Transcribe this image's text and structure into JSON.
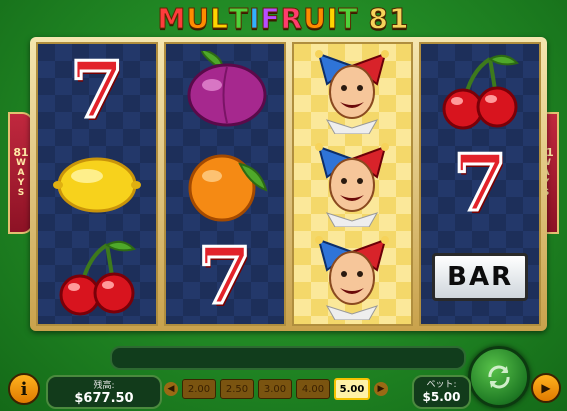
{
  "title": {
    "letters": [
      "M",
      "U",
      "L",
      "T",
      "I",
      "F",
      "R",
      "U",
      "I",
      "T"
    ],
    "letter_colors": [
      "#ff3c3c",
      "#ff8c00",
      "#ffd400",
      "#4fd13a",
      "#33b0ff",
      "#b84dff",
      "#ff3c6e",
      "#ff8c00",
      "#ffd400",
      "#4fd13a"
    ],
    "number": "81"
  },
  "side_panels": {
    "ways_number": "81",
    "ways_word": [
      "W",
      "A",
      "Y",
      "S"
    ]
  },
  "reels": [
    {
      "win": false,
      "symbols": [
        "seven-symbol",
        "lemon-symbol",
        "cherries-symbol"
      ]
    },
    {
      "win": false,
      "symbols": [
        "plum-symbol",
        "orange-symbol",
        "seven-symbol"
      ]
    },
    {
      "win": true,
      "symbols": [
        "jester-symbol",
        "jester-symbol",
        "jester-symbol"
      ]
    },
    {
      "win": false,
      "symbols": [
        "cherries-symbol",
        "seven-symbol",
        "bar-symbol"
      ]
    }
  ],
  "symbol_text": {
    "seven": "7",
    "bar": "BAR"
  },
  "controls": {
    "info_label": "i",
    "balance_label": "残高:",
    "balance_value": "$677.50",
    "bet_options": [
      "2.00",
      "2.50",
      "3.00",
      "4.00",
      "5.00"
    ],
    "selected_bet": "5.00",
    "bet_label": "ベット:",
    "bet_value": "$5.00",
    "spin_icon": "refresh-arrows-icon",
    "autoplay_icon": "play-icon"
  },
  "colors": {
    "background": "#238c26",
    "reel_bg": "#1d2f5a",
    "win_reel_bg": "#f4d86a",
    "seven_red": "#e2222a",
    "accent_orange": "#ffb21e"
  }
}
